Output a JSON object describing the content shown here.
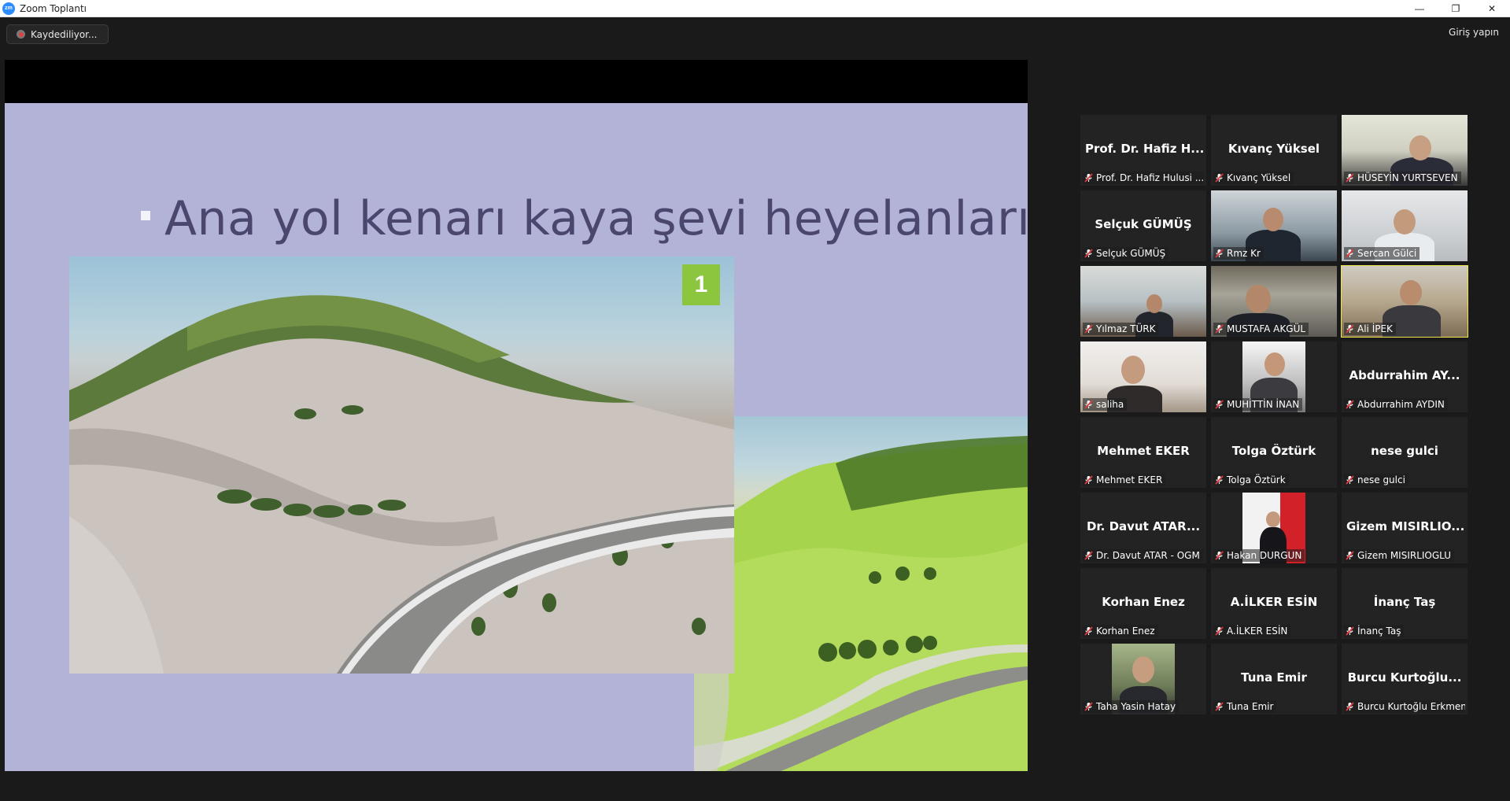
{
  "window": {
    "title": "Zoom Toplantı",
    "minimize_glyph": "—",
    "maximize_glyph": "❐",
    "close_glyph": "✕"
  },
  "toolbar": {
    "recording_label": "Kaydediliyor...",
    "signin_label": "Giriş yapın"
  },
  "slide": {
    "title_text": "Ana yol kenarı kaya şevi heyelanları ve kaya",
    "badge_number": "1"
  },
  "participants": [
    {
      "name": "Prof. Dr. Hafiz Hulusi ...",
      "display": "Prof. Dr. Hafiz H...",
      "video": false
    },
    {
      "name": "Kıvanç Yüksel",
      "display": "Kıvanç Yüksel",
      "video": false
    },
    {
      "name": "HÜSEYİN YURTSEVEN",
      "display": "",
      "video": true
    },
    {
      "name": "Selçuk GÜMÜŞ",
      "display": "Selçuk GÜMÜŞ",
      "video": false
    },
    {
      "name": "Rmz Kr",
      "display": "",
      "video": true
    },
    {
      "name": "Sercan Gülci",
      "display": "",
      "video": true
    },
    {
      "name": "Yılmaz TÜRK",
      "display": "",
      "video": true
    },
    {
      "name": "MUSTAFA AKGÜL",
      "display": "",
      "video": true
    },
    {
      "name": "Ali İPEK",
      "display": "",
      "video": true,
      "active_speaker": true
    },
    {
      "name": "saliha",
      "display": "",
      "video": true
    },
    {
      "name": "MUHİTTİN İNAN",
      "display": "",
      "video": true
    },
    {
      "name": "Abdurrahim AYDIN",
      "display": "Abdurrahim AY...",
      "video": false
    },
    {
      "name": "Mehmet EKER",
      "display": "Mehmet EKER",
      "video": false
    },
    {
      "name": "Tolga Öztürk",
      "display": "Tolga Öztürk",
      "video": false
    },
    {
      "name": "nese gulci",
      "display": "nese gulci",
      "video": false
    },
    {
      "name": "Dr. Davut ATAR - OGM",
      "display": "Dr. Davut ATAR...",
      "video": false
    },
    {
      "name": "Hakan DURGUN",
      "display": "",
      "video": true
    },
    {
      "name": "Gizem MISIRLIOGLU",
      "display": "Gizem MISIRLIO...",
      "video": false
    },
    {
      "name": "Korhan Enez",
      "display": "Korhan Enez",
      "video": false
    },
    {
      "name": "A.İLKER ESİN",
      "display": "A.İLKER ESİN",
      "video": false
    },
    {
      "name": "İnanç Taş",
      "display": "İnanç Taş",
      "video": false
    },
    {
      "name": "Taha Yasin Hatay",
      "display": "",
      "video": true
    },
    {
      "name": "Tuna Emir",
      "display": "Tuna Emir",
      "video": false
    },
    {
      "name": "Burcu Kurtoğlu Erkmen",
      "display": "Burcu Kurtoğlu...",
      "video": false
    }
  ],
  "colors": {
    "active_speaker_border": "#f1e54e",
    "muted_icon": "#e0393e",
    "slide_background": "#b3b3d7",
    "badge": "#8cc63f"
  }
}
